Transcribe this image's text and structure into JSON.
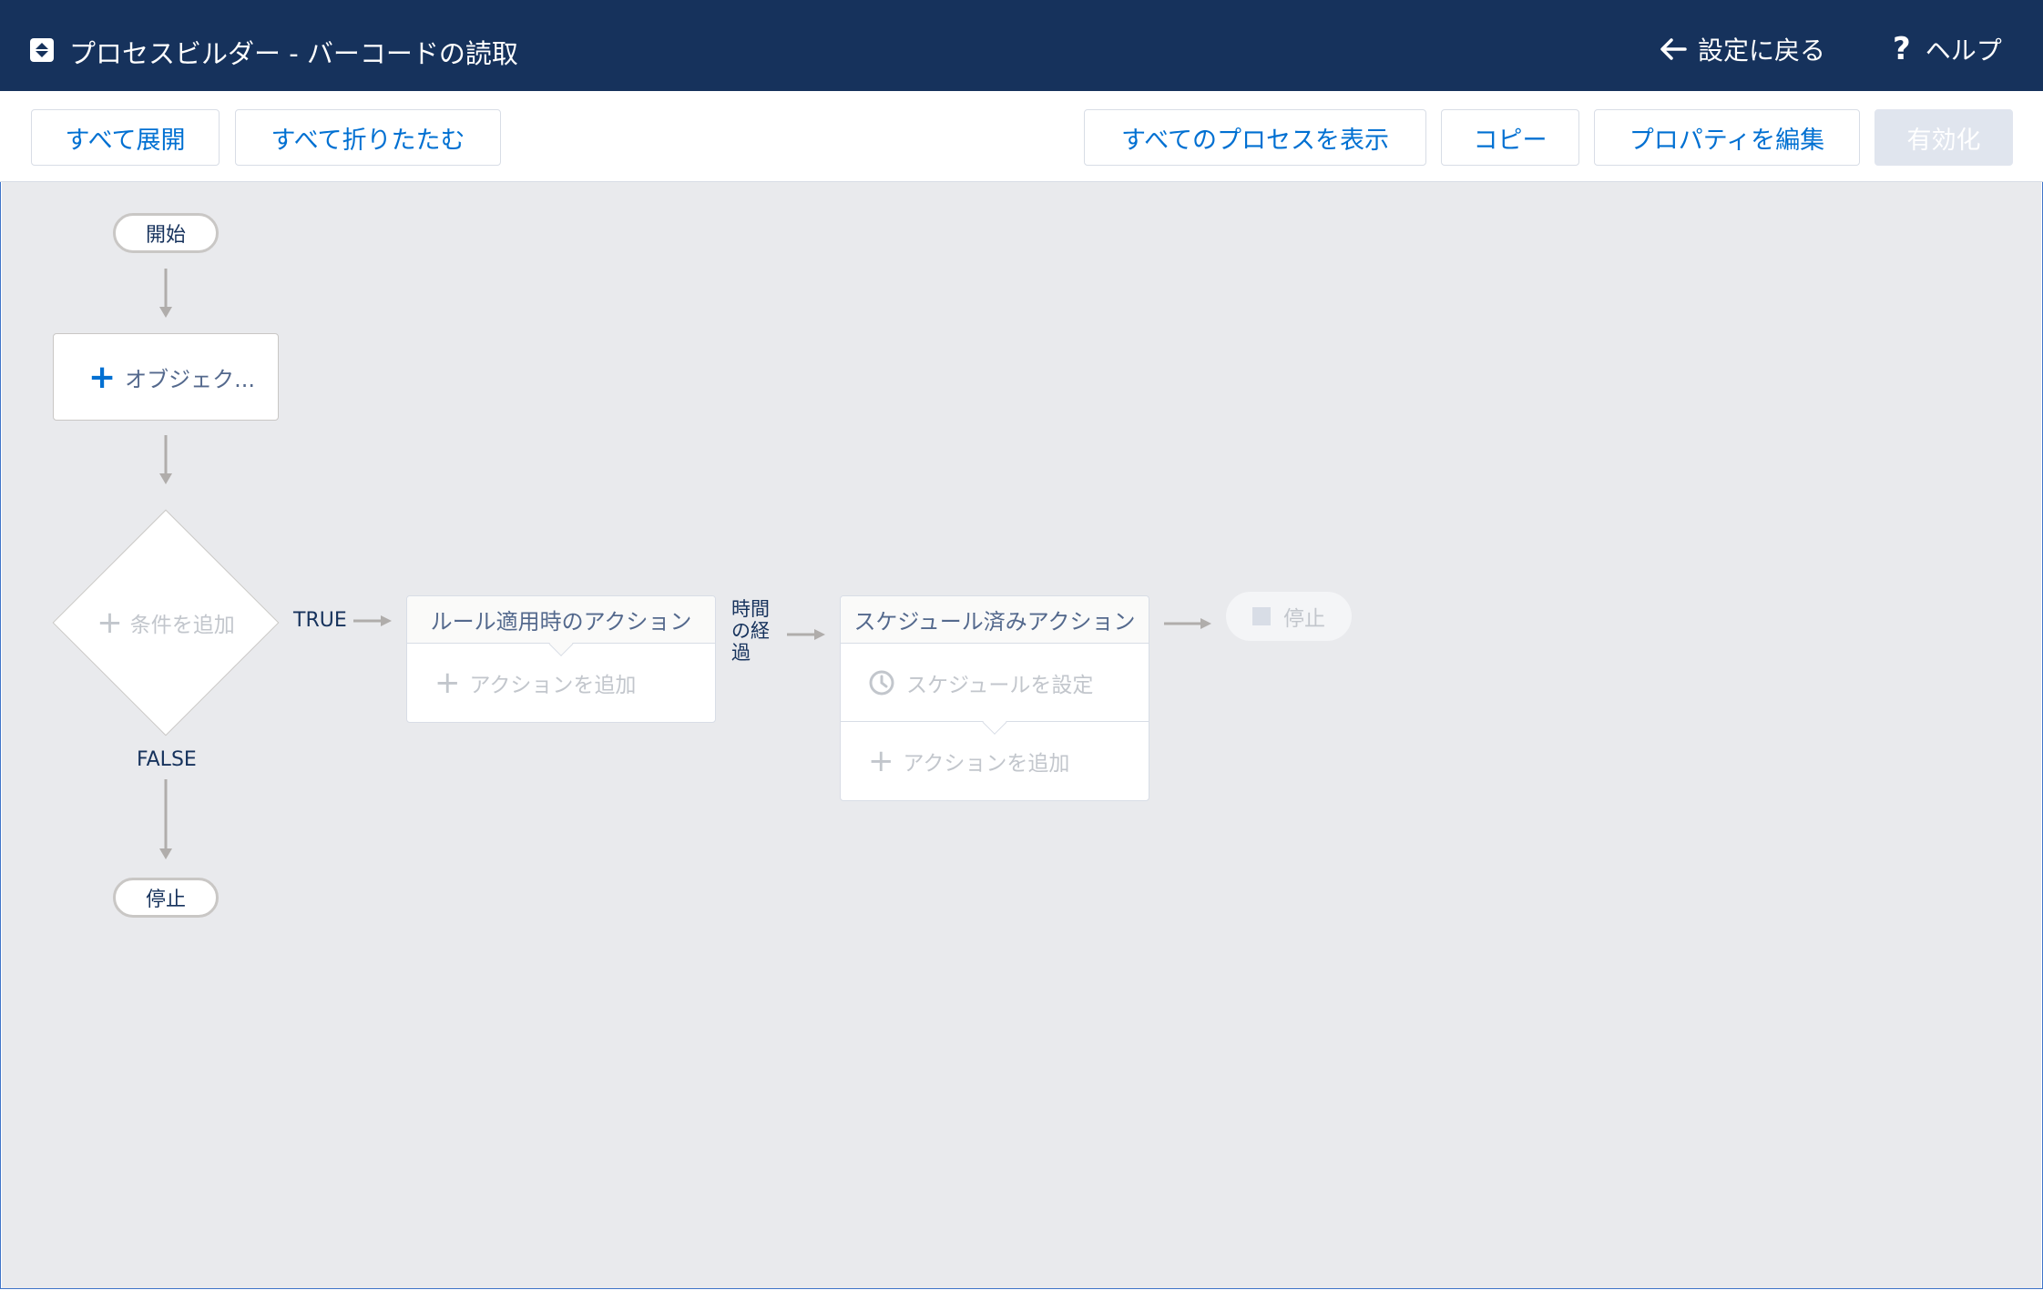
{
  "header": {
    "title": "プロセスビルダー - バーコードの読取",
    "back_label": "設定に戻る",
    "help_label": "ヘルプ"
  },
  "toolbar": {
    "expand_all": "すべて展開",
    "collapse_all": "すべて折りたたむ",
    "view_all_processes": "すべてのプロセスを表示",
    "copy": "コピー",
    "edit_properties": "プロパティを編集",
    "activate": "有効化"
  },
  "canvas": {
    "start_label": "開始",
    "object_label": "オブジェク...",
    "condition_label": "条件を追加",
    "true_label": "TRUE",
    "false_label": "FALSE",
    "stop_label": "停止",
    "immediate_actions": {
      "title": "ルール適用時のアクション",
      "add_action": "アクションを追加"
    },
    "time_elapsed_label": "時間の経過",
    "scheduled_actions": {
      "title": "スケジュール済みアクション",
      "set_schedule": "スケジュールを設定",
      "add_action": "アクションを追加"
    },
    "end_stop_label": "停止"
  },
  "colors": {
    "header_bg": "#16325c",
    "link_blue": "#0070d2",
    "canvas_bg": "#e9eaed",
    "disabled_btn": "#e0e5ee"
  }
}
